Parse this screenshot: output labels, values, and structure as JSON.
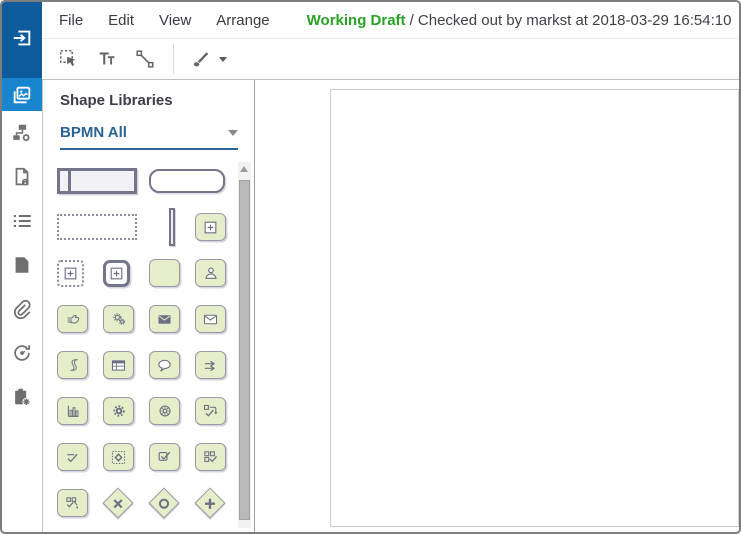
{
  "menu_bar": {
    "items": [
      "File",
      "Edit",
      "View",
      "Arrange"
    ],
    "status": {
      "draft_label": "Working Draft",
      "checked_out_text": "/ Checked out by markst at 2018-03-29 16:54:10"
    }
  },
  "toolbar": {
    "tools": [
      {
        "name": "marquee-select-tool",
        "icon": "marquee-select-icon"
      },
      {
        "name": "text-tool",
        "icon": "text-icon"
      },
      {
        "name": "connector-tool",
        "icon": "connector-icon",
        "separator_after": true
      },
      {
        "name": "style-brush-tool",
        "icon": "brush-icon",
        "has_dropdown": true
      }
    ]
  },
  "sidebar": {
    "items": [
      {
        "name": "collapse-panel",
        "icon": "collapse-icon",
        "style": "dark"
      },
      {
        "name": "shape-libraries",
        "icon": "shapes-panel-icon",
        "active": true
      },
      {
        "name": "process-structure",
        "icon": "sitemap-gear-icon"
      },
      {
        "name": "document-info",
        "icon": "file-info-icon"
      },
      {
        "name": "outline-list",
        "icon": "list-icon"
      },
      {
        "name": "pages",
        "icon": "page-icon"
      },
      {
        "name": "attachments",
        "icon": "paperclip-icon"
      },
      {
        "name": "history",
        "icon": "history-icon"
      },
      {
        "name": "clipboard-settings",
        "icon": "clipboard-gear-icon"
      }
    ]
  },
  "shape_panel": {
    "title": "Shape Libraries",
    "library_dropdown": {
      "value": "BPMN All",
      "icon": "chevron-down-icon"
    },
    "rows": [
      [
        {
          "name": "pool",
          "kind": "pool",
          "span": 2
        },
        {
          "name": "task",
          "kind": "task",
          "span": 2
        }
      ],
      [
        {
          "name": "group",
          "kind": "dotted-wide",
          "span": 2
        },
        {
          "name": "lane-divider",
          "kind": "bar"
        },
        {
          "name": "subprocess",
          "kind": "green",
          "icon": "plus-box-icon"
        }
      ],
      [
        {
          "name": "event-subprocess",
          "kind": "dotted-cell",
          "icon": "plus-box-icon"
        },
        {
          "name": "call-activity",
          "kind": "thick-cell",
          "icon": "plus-box-icon"
        },
        {
          "name": "plain-task",
          "kind": "green"
        },
        {
          "name": "user-task",
          "kind": "green",
          "icon": "person-icon"
        }
      ],
      [
        {
          "name": "manual-task",
          "kind": "green",
          "icon": "hand-icon"
        },
        {
          "name": "service-task",
          "kind": "green",
          "icon": "gears-icon"
        },
        {
          "name": "send-task",
          "kind": "green",
          "icon": "envelope-filled-icon"
        },
        {
          "name": "receive-task",
          "kind": "green",
          "icon": "envelope-icon"
        }
      ],
      [
        {
          "name": "script-task",
          "kind": "green",
          "icon": "script-icon"
        },
        {
          "name": "business-rule-task",
          "kind": "green",
          "icon": "table-icon"
        },
        {
          "name": "annotation-task",
          "kind": "green",
          "icon": "speech-bubble-icon"
        },
        {
          "name": "send-receive-task",
          "kind": "green",
          "icon": "double-arrow-icon"
        }
      ],
      [
        {
          "name": "report-task",
          "kind": "green",
          "icon": "bar-chart-icon"
        },
        {
          "name": "automation-task",
          "kind": "green",
          "icon": "gear-icon"
        },
        {
          "name": "wheel-task",
          "kind": "green",
          "icon": "wheel-icon"
        },
        {
          "name": "check-flow-task",
          "kind": "green",
          "icon": "check-arrow-icon"
        }
      ],
      [
        {
          "name": "approval-task",
          "kind": "green",
          "icon": "check-line-icon"
        },
        {
          "name": "embedded-process",
          "kind": "green",
          "icon": "dotted-diamond-icon"
        },
        {
          "name": "completed-task",
          "kind": "green",
          "icon": "box-check-icon"
        },
        {
          "name": "multi-task",
          "kind": "green",
          "icon": "squares-check-icon"
        }
      ],
      [
        {
          "name": "multi-task-flow",
          "kind": "green",
          "icon": "squares-check-arrow-icon"
        },
        {
          "name": "exclusive-gateway",
          "kind": "diamond",
          "icon": "x-mark-icon"
        },
        {
          "name": "inclusive-gateway",
          "kind": "diamond",
          "icon": "circle-mark-icon"
        },
        {
          "name": "parallel-gateway",
          "kind": "diamond",
          "icon": "plus-mark-icon"
        }
      ]
    ]
  },
  "colors": {
    "sidebar_dark": "#0d5a9c",
    "sidebar_active": "#1a85cf",
    "draft_green": "#28a125",
    "library_accent": "#2a6496",
    "shape_fill": "#e5edc9",
    "shape_stroke": "#6e6e82"
  }
}
